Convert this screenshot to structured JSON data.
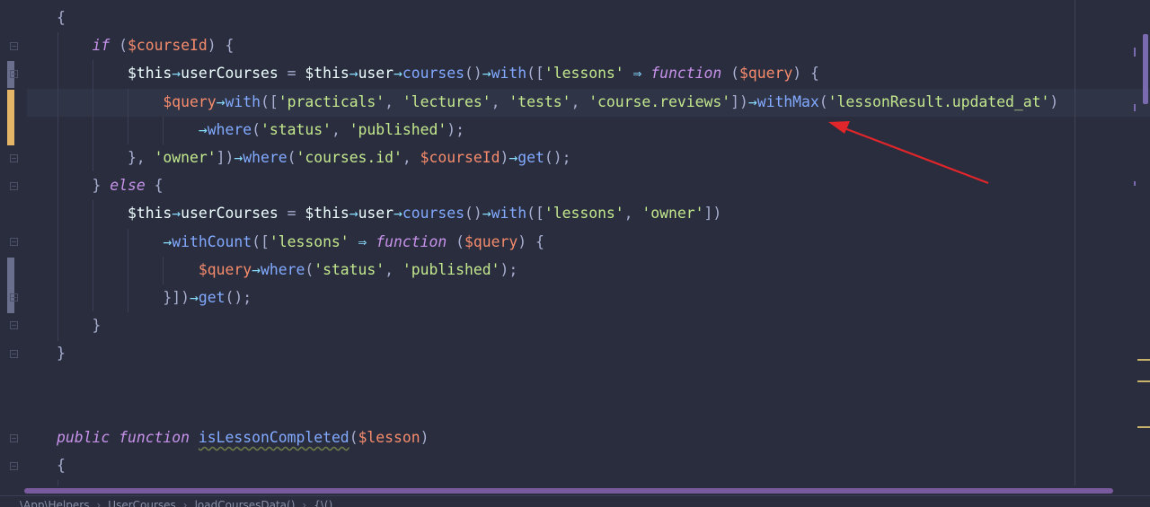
{
  "editor": {
    "lines": [
      [
        {
          "t": "{",
          "c": "plain"
        }
      ],
      [
        {
          "t": "    ",
          "c": "plain"
        },
        {
          "t": "if",
          "c": "kw"
        },
        {
          "t": " (",
          "c": "plain"
        },
        {
          "t": "$courseId",
          "c": "var"
        },
        {
          "t": ") {",
          "c": "plain"
        }
      ],
      [
        {
          "t": "        ",
          "c": "plain"
        },
        {
          "t": "$this",
          "c": "this"
        },
        {
          "t": "→",
          "c": "op"
        },
        {
          "t": "userCourses",
          "c": "this"
        },
        {
          "t": " = ",
          "c": "plain"
        },
        {
          "t": "$this",
          "c": "this"
        },
        {
          "t": "→",
          "c": "op"
        },
        {
          "t": "user",
          "c": "this"
        },
        {
          "t": "→",
          "c": "op"
        },
        {
          "t": "courses",
          "c": "fn"
        },
        {
          "t": "()",
          "c": "plain"
        },
        {
          "t": "→",
          "c": "op"
        },
        {
          "t": "with",
          "c": "fn"
        },
        {
          "t": "([",
          "c": "plain"
        },
        {
          "t": "'lessons'",
          "c": "str"
        },
        {
          "t": " ⇒ ",
          "c": "op"
        },
        {
          "t": "function",
          "c": "kw"
        },
        {
          "t": " (",
          "c": "plain"
        },
        {
          "t": "$query",
          "c": "var"
        },
        {
          "t": ") {",
          "c": "plain"
        }
      ],
      [
        {
          "t": "            ",
          "c": "plain"
        },
        {
          "t": "$query",
          "c": "var"
        },
        {
          "t": "→",
          "c": "op"
        },
        {
          "t": "with",
          "c": "fn"
        },
        {
          "t": "([",
          "c": "plain"
        },
        {
          "t": "'practicals'",
          "c": "str"
        },
        {
          "t": ", ",
          "c": "plain"
        },
        {
          "t": "'lectures'",
          "c": "str"
        },
        {
          "t": ", ",
          "c": "plain"
        },
        {
          "t": "'tests'",
          "c": "str"
        },
        {
          "t": ", ",
          "c": "plain"
        },
        {
          "t": "'course.reviews'",
          "c": "str"
        },
        {
          "t": "])",
          "c": "plain"
        },
        {
          "t": "→",
          "c": "op"
        },
        {
          "t": "withMax",
          "c": "fn"
        },
        {
          "t": "(",
          "c": "plain"
        },
        {
          "t": "'lessonResult.updated_at'",
          "c": "str"
        },
        {
          "t": ")",
          "c": "plain"
        }
      ],
      [
        {
          "t": "                ",
          "c": "plain"
        },
        {
          "t": "→",
          "c": "op"
        },
        {
          "t": "where",
          "c": "fn"
        },
        {
          "t": "(",
          "c": "plain"
        },
        {
          "t": "'status'",
          "c": "str"
        },
        {
          "t": ", ",
          "c": "plain"
        },
        {
          "t": "'published'",
          "c": "str"
        },
        {
          "t": ");",
          "c": "plain"
        }
      ],
      [
        {
          "t": "        }, ",
          "c": "plain"
        },
        {
          "t": "'owner'",
          "c": "str"
        },
        {
          "t": "])",
          "c": "plain"
        },
        {
          "t": "→",
          "c": "op"
        },
        {
          "t": "where",
          "c": "fn"
        },
        {
          "t": "(",
          "c": "plain"
        },
        {
          "t": "'courses.id'",
          "c": "str"
        },
        {
          "t": ", ",
          "c": "plain"
        },
        {
          "t": "$courseId",
          "c": "var"
        },
        {
          "t": ")",
          "c": "plain"
        },
        {
          "t": "→",
          "c": "op"
        },
        {
          "t": "get",
          "c": "fn"
        },
        {
          "t": "();",
          "c": "plain"
        }
      ],
      [
        {
          "t": "    } ",
          "c": "plain"
        },
        {
          "t": "else",
          "c": "kw"
        },
        {
          "t": " {",
          "c": "plain"
        }
      ],
      [
        {
          "t": "        ",
          "c": "plain"
        },
        {
          "t": "$this",
          "c": "this"
        },
        {
          "t": "→",
          "c": "op"
        },
        {
          "t": "userCourses",
          "c": "this"
        },
        {
          "t": " = ",
          "c": "plain"
        },
        {
          "t": "$this",
          "c": "this"
        },
        {
          "t": "→",
          "c": "op"
        },
        {
          "t": "user",
          "c": "this"
        },
        {
          "t": "→",
          "c": "op"
        },
        {
          "t": "courses",
          "c": "fn"
        },
        {
          "t": "()",
          "c": "plain"
        },
        {
          "t": "→",
          "c": "op"
        },
        {
          "t": "with",
          "c": "fn"
        },
        {
          "t": "([",
          "c": "plain"
        },
        {
          "t": "'lessons'",
          "c": "str"
        },
        {
          "t": ", ",
          "c": "plain"
        },
        {
          "t": "'owner'",
          "c": "str"
        },
        {
          "t": "])",
          "c": "plain"
        }
      ],
      [
        {
          "t": "            ",
          "c": "plain"
        },
        {
          "t": "→",
          "c": "op"
        },
        {
          "t": "withCount",
          "c": "fn"
        },
        {
          "t": "([",
          "c": "plain"
        },
        {
          "t": "'lessons'",
          "c": "str"
        },
        {
          "t": " ⇒ ",
          "c": "op"
        },
        {
          "t": "function",
          "c": "kw"
        },
        {
          "t": " (",
          "c": "plain"
        },
        {
          "t": "$query",
          "c": "var"
        },
        {
          "t": ") {",
          "c": "plain"
        }
      ],
      [
        {
          "t": "                ",
          "c": "plain"
        },
        {
          "t": "$query",
          "c": "var"
        },
        {
          "t": "→",
          "c": "op"
        },
        {
          "t": "where",
          "c": "fn"
        },
        {
          "t": "(",
          "c": "plain"
        },
        {
          "t": "'status'",
          "c": "str"
        },
        {
          "t": ", ",
          "c": "plain"
        },
        {
          "t": "'published'",
          "c": "str"
        },
        {
          "t": ");",
          "c": "plain"
        }
      ],
      [
        {
          "t": "            }])",
          "c": "plain"
        },
        {
          "t": "→",
          "c": "op"
        },
        {
          "t": "get",
          "c": "fn"
        },
        {
          "t": "();",
          "c": "plain"
        }
      ],
      [
        {
          "t": "    }",
          "c": "plain"
        }
      ],
      [
        {
          "t": "}",
          "c": "plain"
        }
      ],
      [],
      [],
      [
        {
          "t": "public",
          "c": "kw"
        },
        {
          "t": " ",
          "c": "plain"
        },
        {
          "t": "function",
          "c": "kw"
        },
        {
          "t": " ",
          "c": "plain"
        },
        {
          "t": "isLessonCompleted",
          "c": "decl"
        },
        {
          "t": "(",
          "c": "plain"
        },
        {
          "t": "$lesson",
          "c": "var"
        },
        {
          "t": ")",
          "c": "plain"
        }
      ],
      [
        {
          "t": "{",
          "c": "plain"
        }
      ]
    ]
  },
  "breadcrumb": {
    "items": [
      "\\App\\Helpers",
      "UserCourses",
      "loadCoursesData()",
      "{\\()"
    ]
  },
  "colors": {
    "background": "#292d3e",
    "keyword": "#c792ea",
    "variable": "#f78c6c",
    "function": "#82aaff",
    "string": "#c3e88d",
    "operator": "#89ddff",
    "annotation_arrow": "#e0262a"
  }
}
